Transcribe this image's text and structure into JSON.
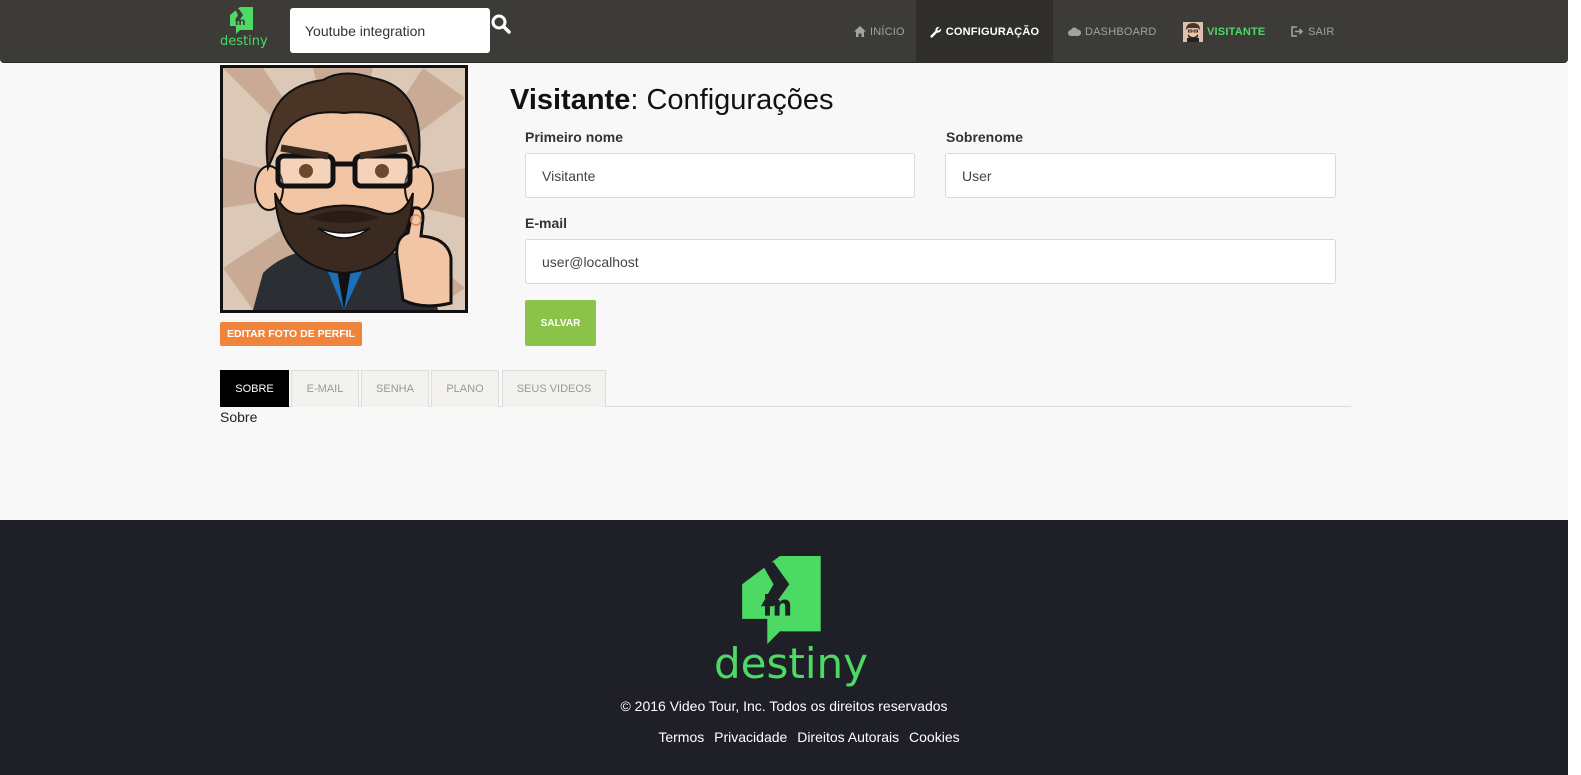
{
  "navbar": {
    "brand_name": "destiny",
    "search": {
      "value": "Youtube integration",
      "placeholder": ""
    },
    "items": [
      {
        "label": "INÍCIO",
        "icon": "home-icon"
      },
      {
        "label": "CONFIGURAÇÃO",
        "icon": "wrench-icon",
        "active": true
      },
      {
        "label": "DASHBOARD",
        "icon": "cloud-icon"
      },
      {
        "label": "VISITANTE",
        "icon": "avatar"
      },
      {
        "label": "SAIR",
        "icon": "sign-out-icon"
      }
    ]
  },
  "profile": {
    "edit_photo_label": "EDITAR FOTO DE PERFIL",
    "title_user": "Visitante",
    "title_rest": ": Configurações",
    "fields": {
      "first_name": {
        "label": "Primeiro nome",
        "value": "Visitante"
      },
      "last_name": {
        "label": "Sobrenome",
        "value": "User"
      },
      "email": {
        "label": "E-mail",
        "value": "user@localhost"
      }
    },
    "save_label": "SALVAR"
  },
  "tabs": [
    {
      "label": "SOBRE",
      "active": true
    },
    {
      "label": "E-MAIL"
    },
    {
      "label": "SENHA"
    },
    {
      "label": "PLANO"
    },
    {
      "label": "SEUS VIDEOS"
    }
  ],
  "tab_content": "Sobre",
  "footer": {
    "brand_name": "destiny",
    "copyright": "© 2016 Video Tour, Inc. Todos os direitos reservados",
    "links": [
      "Termos",
      "Privacidade",
      "Direitos Autorais",
      "Cookies"
    ]
  },
  "colors": {
    "navbar_bg": "#3c3b37",
    "brand_green": "#4cd964",
    "edit_orange": "#f0843c",
    "save_green": "#8bc34a",
    "footer_bg": "#1e1f27"
  }
}
